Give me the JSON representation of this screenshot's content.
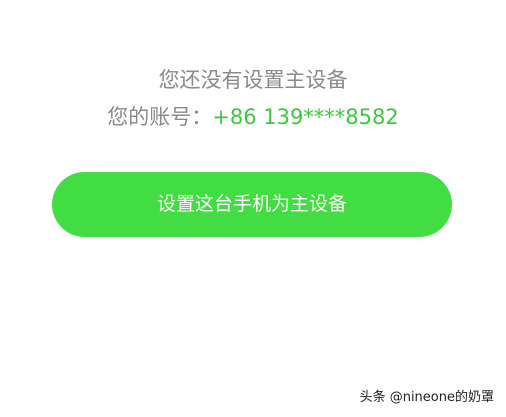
{
  "message": {
    "title": "您还没有设置主设备",
    "account_label": "您的账号：",
    "account_value": "+86 139****8582"
  },
  "button": {
    "label": "设置这台手机为主设备"
  },
  "watermark": "头条 @nineone的奶罩",
  "colors": {
    "accent": "#42dd42",
    "account_value": "#3cc83c",
    "muted_text": "#8a8a8a"
  }
}
